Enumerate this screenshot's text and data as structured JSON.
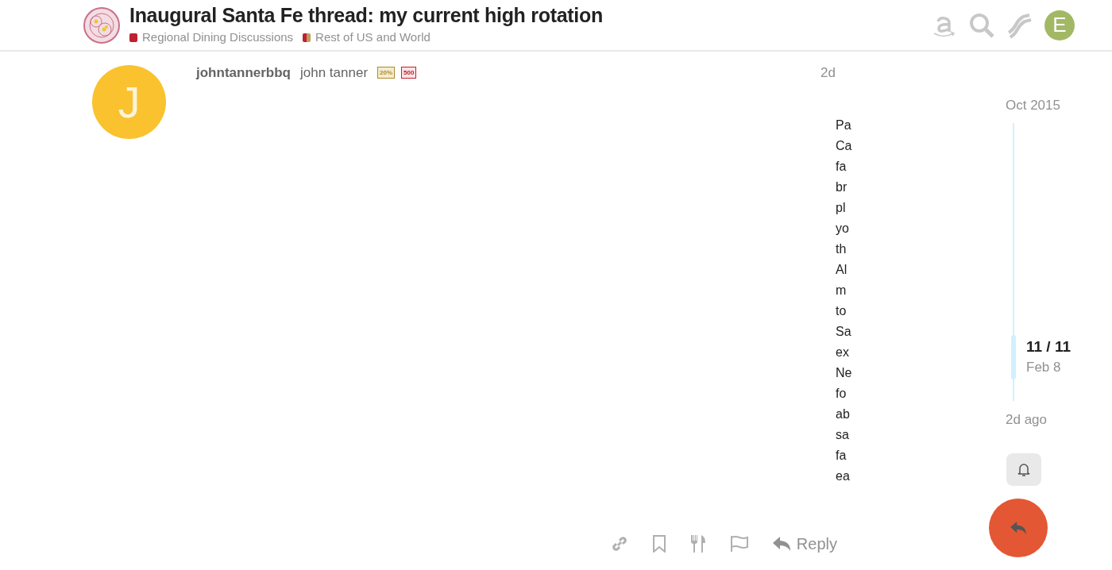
{
  "header": {
    "title": "Inaugural Santa Fe thread: my current high rotation",
    "categories": [
      {
        "name": "Regional Dining Discussions",
        "color": "#c0202f"
      },
      {
        "name": "Rest of US and World",
        "color": "#c0202f"
      }
    ],
    "user_avatar_letter": "E"
  },
  "post": {
    "avatar_letter": "J",
    "username": "johntannerbbq",
    "full_name": "john tanner",
    "badges": [
      "20%",
      "500"
    ],
    "age": "2d",
    "body_lines": [
      "Pa",
      "Ca",
      "fa",
      "br",
      "pl",
      "yo",
      "th",
      "Al",
      "m",
      "to",
      "Sa",
      "ex",
      "Ne",
      "fo",
      "ab",
      "sa",
      "fa",
      "ea"
    ],
    "reply_label": "Reply"
  },
  "timeline": {
    "start": "Oct 2015",
    "position": "11 / 11",
    "position_date": "Feb 8",
    "end": "2d ago"
  }
}
